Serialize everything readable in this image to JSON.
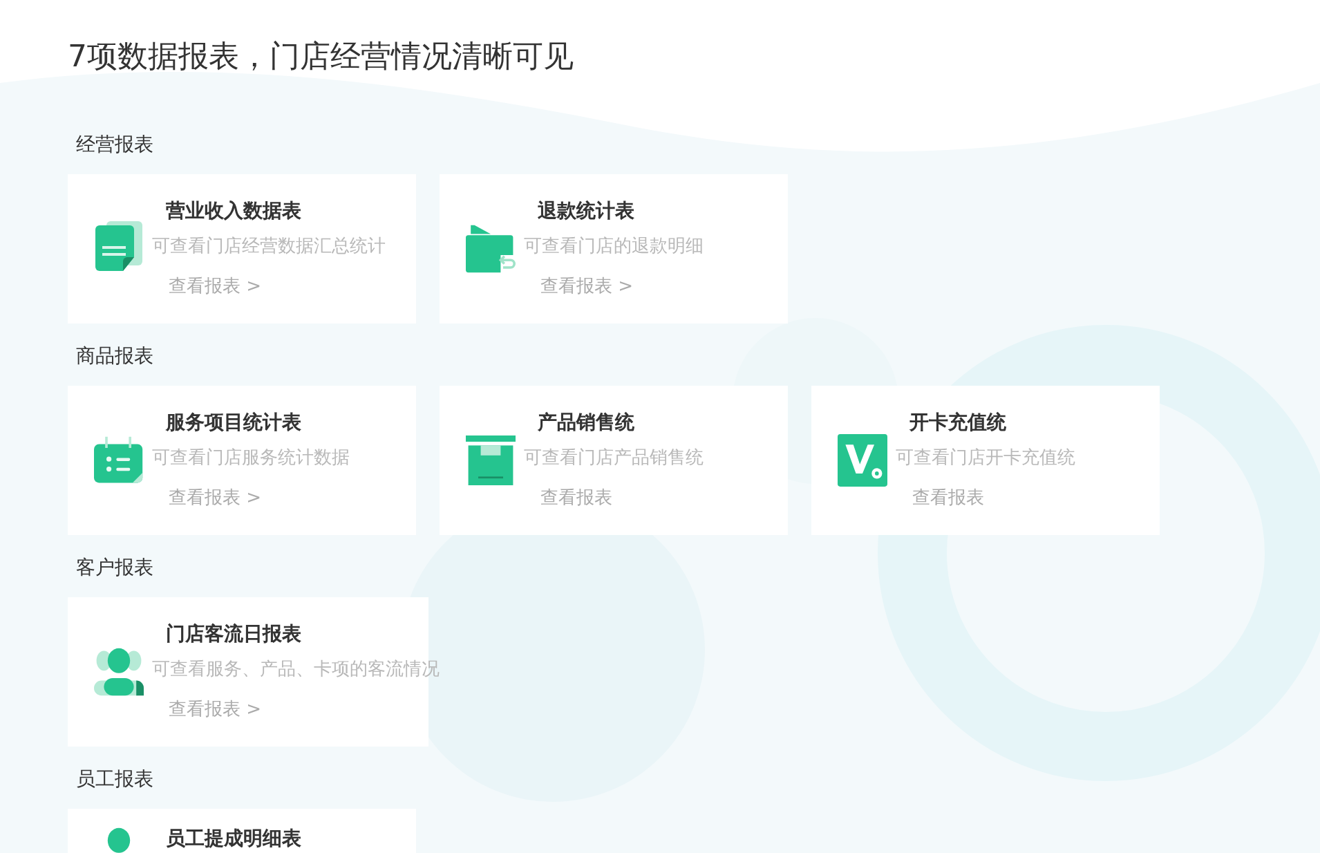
{
  "heading": "7项数据报表，门店经营情况清晰可见",
  "sections": [
    {
      "label": "经营报表",
      "cards": [
        {
          "kind": "document",
          "title": "营业收入数据表",
          "description": "可查看门店经营数据汇总统计",
          "link": "查看报表 >"
        },
        {
          "kind": "wallet",
          "title": "退款统计表",
          "description": "可查看门店的退款明细",
          "link": "查看报表 >"
        }
      ]
    },
    {
      "label": "商品报表",
      "cards": [
        {
          "kind": "calendar",
          "title": "服务项目统计表",
          "description": "可查看门店服务统计数据",
          "link": "查看报表 >"
        },
        {
          "kind": "box",
          "title": "产品销售统",
          "description": "可查看门店产品销售统",
          "link": "查看报表"
        },
        {
          "kind": "vcard",
          "title": "开卡充值统",
          "description": "可查看门店开卡充值统",
          "link": "查看报表"
        }
      ]
    },
    {
      "label": "客户报表",
      "cards": [
        {
          "kind": "people",
          "title": "门店客流日报表",
          "description": "可查看服务、产品、卡项的客流情况",
          "link": "查看报表 >"
        }
      ]
    },
    {
      "label": "员工报表",
      "cards": [
        {
          "kind": "person",
          "title": "员工提成明细表"
        }
      ]
    }
  ]
}
